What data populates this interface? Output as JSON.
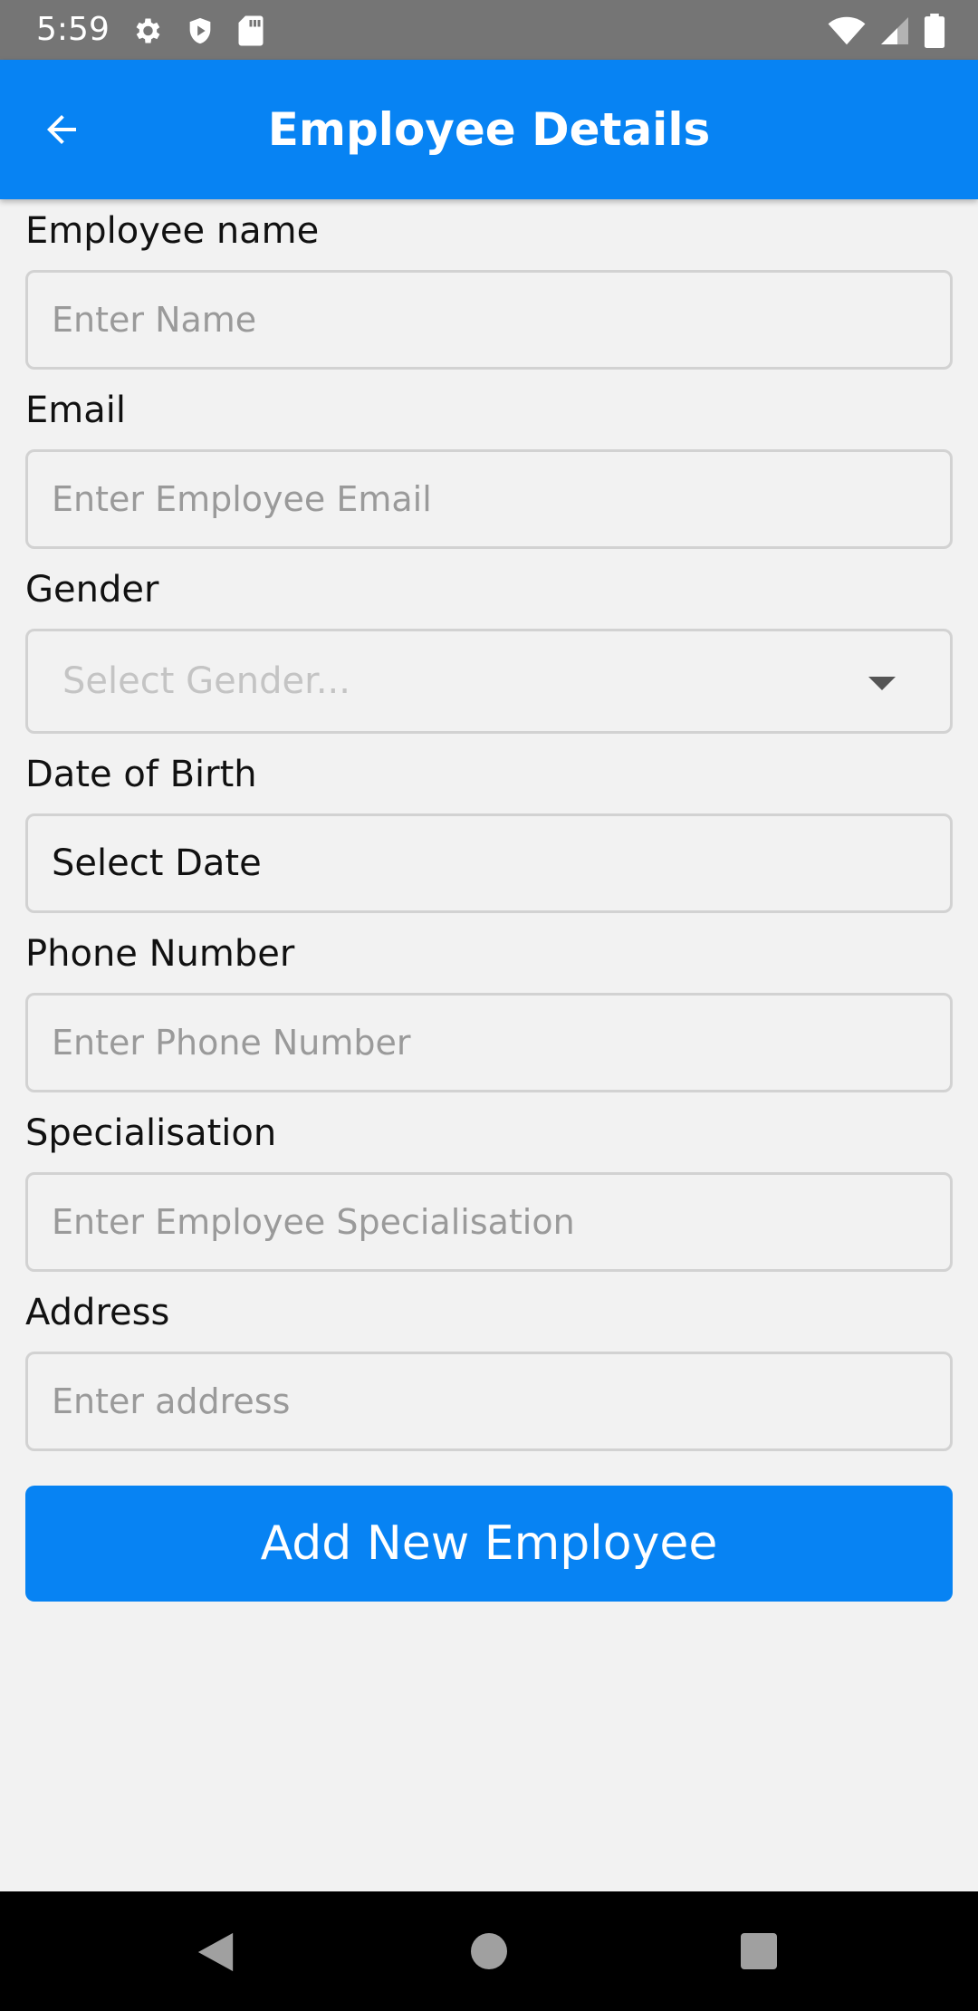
{
  "status_bar": {
    "time": "5:59",
    "icons_left": [
      "gear-icon",
      "shield-icon",
      "sd-card-icon"
    ],
    "icons_right": [
      "wifi-icon",
      "signal-icon",
      "battery-icon"
    ]
  },
  "app_bar": {
    "title": "Employee Details",
    "back_icon": "arrow-left-icon",
    "color": "#0783f3"
  },
  "form": {
    "name": {
      "label": "Employee name",
      "placeholder": "Enter Name",
      "value": ""
    },
    "email": {
      "label": "Email",
      "placeholder": "Enter Employee Email",
      "value": ""
    },
    "gender": {
      "label": "Gender",
      "placeholder": "Select Gender...",
      "icon": "dropdown-arrow-icon"
    },
    "dob": {
      "label": "Date of Birth",
      "value": "Select Date"
    },
    "phone": {
      "label": "Phone Number",
      "placeholder": "Enter Phone Number",
      "value": ""
    },
    "specialisation": {
      "label": "Specialisation",
      "placeholder": "Enter Employee Specialisation",
      "value": ""
    },
    "address": {
      "label": "Address",
      "placeholder": "Enter address",
      "value": ""
    }
  },
  "submit": {
    "label": "Add New Employee"
  },
  "nav_bar": {
    "icons": [
      "nav-back-icon",
      "nav-home-icon",
      "nav-recents-icon"
    ]
  }
}
